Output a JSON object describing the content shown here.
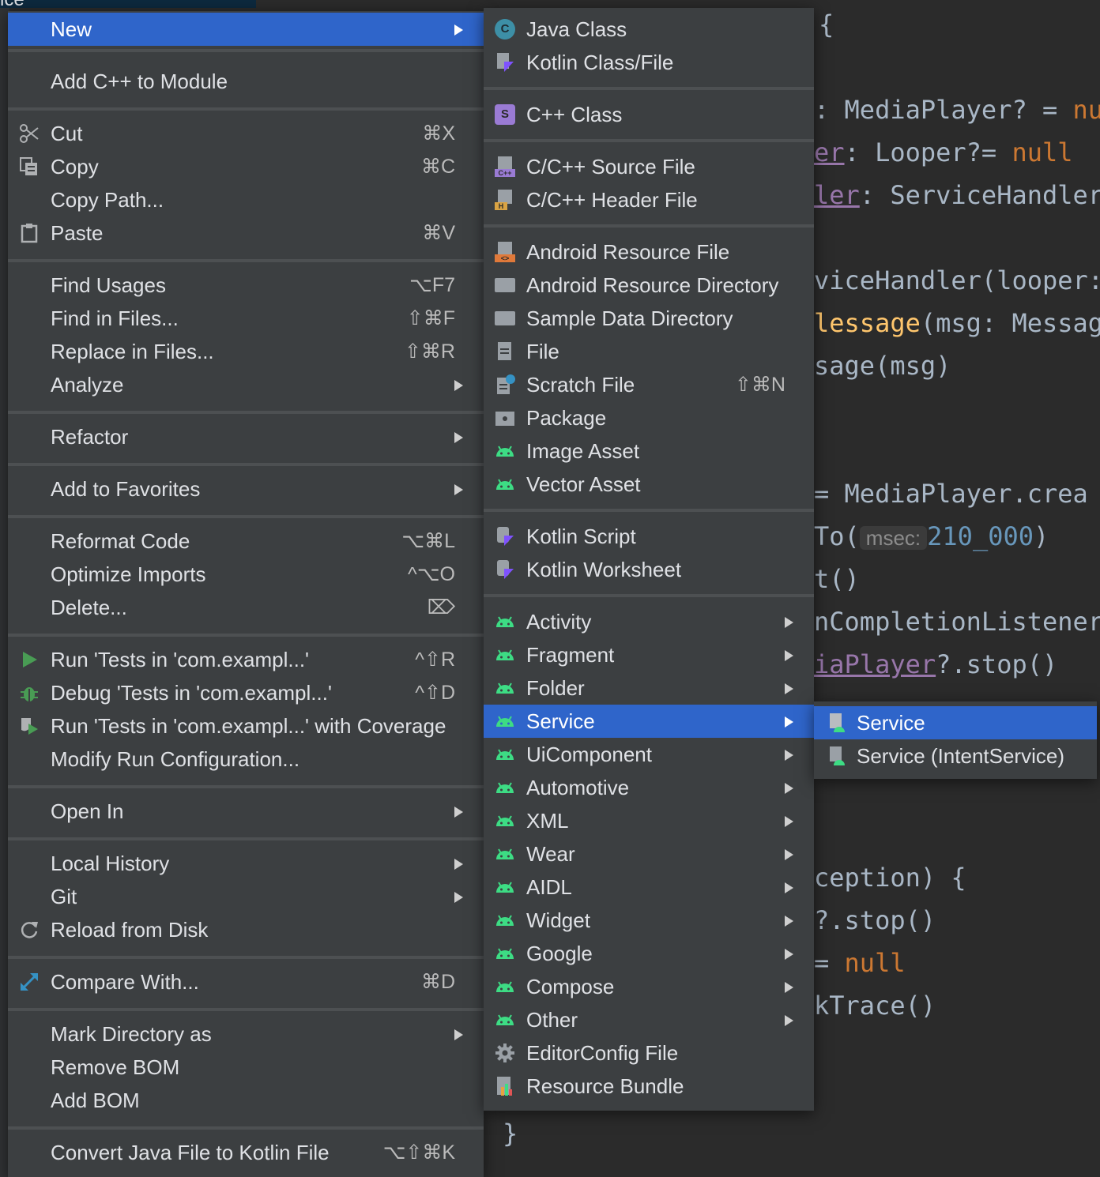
{
  "editor": {
    "top_fragment": "ice",
    "code": {
      "brace_open": "{",
      "l1_text": ": MediaPlayer? = ",
      "l1_kw": "nu",
      "l2_prop": "er",
      "l2_text": ": Looper?= ",
      "l2_kw": "null",
      "l3_prop": "ler",
      "l3_text": ": ServiceHandler",
      "l4": "viceHandler(looper:",
      "l5_fn": "lessage",
      "l5_text": "(msg: Messag",
      "l6": "sage(msg)",
      "l7_text": "= MediaPlayer.crea",
      "l8_pre": "To(",
      "l8_hint": "msec:",
      "l8_num": "210_000",
      "l8_post": ")",
      "l9": "t()",
      "l10": "nCompletionListener",
      "l11_prop": "iaPlayer",
      "l11_text": "?.stop()",
      "l12": "ception) {",
      "l13": "?.stop()",
      "l14_text": "= ",
      "l14_kw": "null",
      "l15": "kTrace()",
      "brace_close": "}"
    }
  },
  "menu1": {
    "new": "New",
    "add_cpp": "Add C++ to Module",
    "cut": "Cut",
    "cut_sc": "⌘X",
    "copy": "Copy",
    "copy_sc": "⌘C",
    "copy_path": "Copy Path...",
    "paste": "Paste",
    "paste_sc": "⌘V",
    "find_usages": "Find Usages",
    "find_usages_sc": "⌥F7",
    "find_in_files": "Find in Files...",
    "find_in_files_sc": "⇧⌘F",
    "replace_in_files": "Replace in Files...",
    "replace_in_files_sc": "⇧⌘R",
    "analyze": "Analyze",
    "refactor": "Refactor",
    "add_to_favorites": "Add to Favorites",
    "reformat_code": "Reformat Code",
    "reformat_code_sc": "⌥⌘L",
    "optimize_imports": "Optimize Imports",
    "optimize_imports_sc": "^⌥O",
    "delete": "Delete...",
    "delete_sc": "⌦",
    "run_tests": "Run 'Tests in 'com.exampl...'",
    "run_tests_sc": "^⇧R",
    "debug_tests": "Debug 'Tests in 'com.exampl...'",
    "debug_tests_sc": "^⇧D",
    "run_coverage": "Run 'Tests in 'com.exampl...' with Coverage",
    "modify_run_config": "Modify Run Configuration...",
    "open_in": "Open In",
    "local_history": "Local History",
    "git": "Git",
    "reload_from_disk": "Reload from Disk",
    "compare_with": "Compare With...",
    "compare_with_sc": "⌘D",
    "mark_directory_as": "Mark Directory as",
    "remove_bom": "Remove BOM",
    "add_bom": "Add BOM",
    "convert_java": "Convert Java File to Kotlin File",
    "convert_java_sc": "⌥⇧⌘K"
  },
  "menu2": {
    "java_class": "Java Class",
    "kotlin_class": "Kotlin Class/File",
    "cpp_class": "C++ Class",
    "cpp_source": "C/C++ Source File",
    "cpp_header": "C/C++ Header File",
    "android_resource_file": "Android Resource File",
    "android_resource_dir": "Android Resource Directory",
    "sample_data_dir": "Sample Data Directory",
    "file": "File",
    "scratch_file": "Scratch File",
    "scratch_file_sc": "⇧⌘N",
    "package": "Package",
    "image_asset": "Image Asset",
    "vector_asset": "Vector Asset",
    "kotlin_script": "Kotlin Script",
    "kotlin_worksheet": "Kotlin Worksheet",
    "activity": "Activity",
    "fragment": "Fragment",
    "folder": "Folder",
    "service": "Service",
    "uicomponent": "UiComponent",
    "automotive": "Automotive",
    "xml": "XML",
    "wear": "Wear",
    "aidl": "AIDL",
    "widget": "Widget",
    "google": "Google",
    "compose": "Compose",
    "other": "Other",
    "editorconfig": "EditorConfig File",
    "resource_bundle": "Resource Bundle"
  },
  "menu3": {
    "service": "Service",
    "intent_service": "Service (IntentService)"
  },
  "icons": {
    "c_letter": "C",
    "s_letter": "S",
    "cpp_badge": "C++",
    "h_badge": "H",
    "res_badge": "<>"
  },
  "colors": {
    "selection": "#2f65ca",
    "menu_bg": "#3c3f41",
    "android_green": "#3ddc84"
  }
}
